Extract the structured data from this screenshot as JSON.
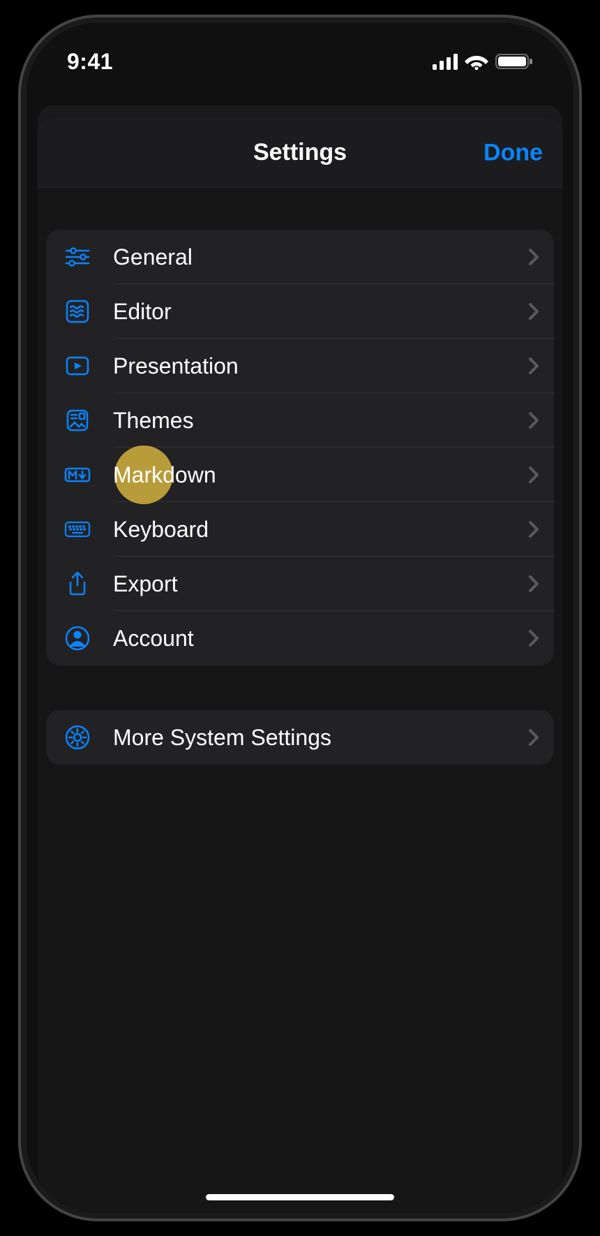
{
  "status": {
    "time": "9:41"
  },
  "header": {
    "title": "Settings",
    "done": "Done"
  },
  "groups": [
    {
      "items": [
        {
          "icon": "sliders-icon",
          "label": "General"
        },
        {
          "icon": "editor-icon",
          "label": "Editor"
        },
        {
          "icon": "play-icon",
          "label": "Presentation"
        },
        {
          "icon": "themes-icon",
          "label": "Themes"
        },
        {
          "icon": "markdown-icon",
          "label": "Markdown",
          "highlighted": true
        },
        {
          "icon": "keyboard-icon",
          "label": "Keyboard"
        },
        {
          "icon": "share-icon",
          "label": "Export"
        },
        {
          "icon": "account-icon",
          "label": "Account"
        }
      ]
    },
    {
      "items": [
        {
          "icon": "gear-circle-icon",
          "label": "More System Settings"
        }
      ]
    }
  ]
}
